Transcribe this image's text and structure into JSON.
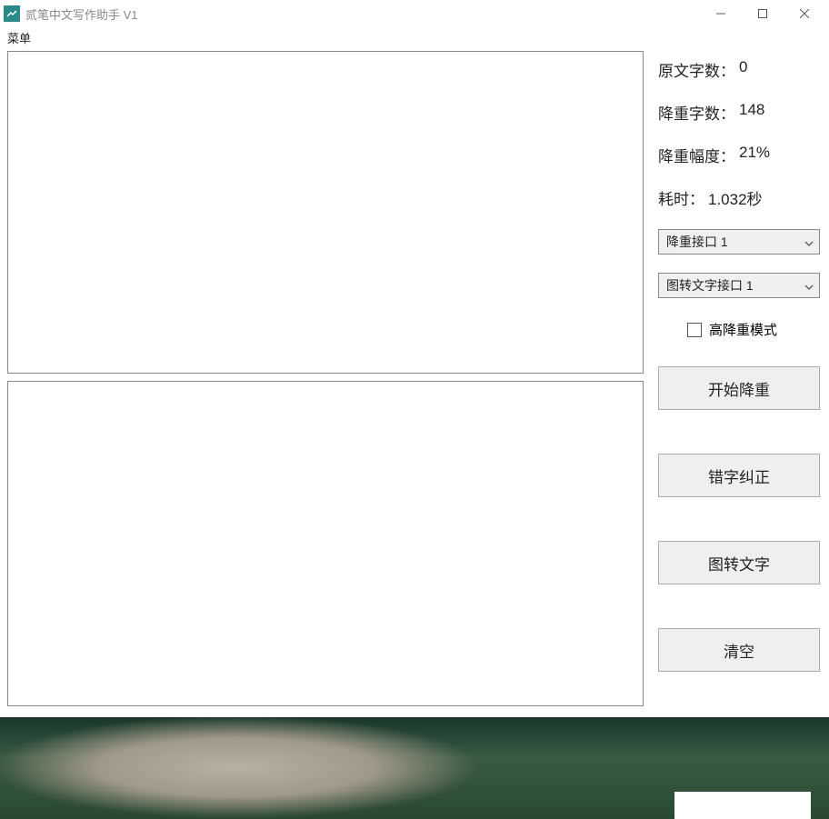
{
  "window": {
    "title": "贰笔中文写作助手 V1"
  },
  "menu": {
    "label": "菜单"
  },
  "textareas": {
    "input_value": "",
    "output_value": ""
  },
  "stats": {
    "original_label": "原文字数：",
    "original_value": "0",
    "reduced_label": "降重字数：",
    "reduced_value": "148",
    "ratio_label": "降重幅度：",
    "ratio_value": "21%",
    "time_label": "耗时：",
    "time_value": "1.032秒"
  },
  "dropdowns": {
    "reduce_api": "降重接口 1",
    "ocr_api": "图转文字接口 1"
  },
  "checkbox": {
    "high_mode_label": "高降重模式"
  },
  "buttons": {
    "start": "开始降重",
    "typo": "错字纠正",
    "ocr": "图转文字",
    "clear": "清空"
  }
}
